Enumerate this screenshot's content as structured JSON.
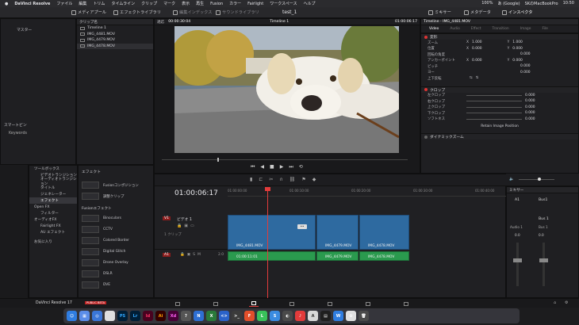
{
  "menubar": {
    "app": "DaVinci Resolve",
    "items": [
      "ファイル",
      "編集",
      "トリム",
      "タイムライン",
      "クリップ",
      "マーク",
      "表示",
      "再生",
      "Fusion",
      "カラー",
      "Fairlight",
      "ワークスペース",
      "ヘルプ"
    ],
    "battery": "100%",
    "input": "あ (Google)",
    "device": "SKのMacBookPro",
    "clock": "10:50"
  },
  "toolbar": {
    "media_pool": "メディアプール",
    "effects_library": "エフェクトライブラリ",
    "edit_index": "編集インデックス",
    "sound_library": "サウンドライブラリ",
    "project_title": "test_1",
    "mixer": "ミキサー",
    "metadata": "メタデータ",
    "inspector": "インスペクタ"
  },
  "mediapool": {
    "bin_header": "クリップ名",
    "master": "マスター",
    "clips": [
      "Timeline 1",
      "IMG_4481.MOV",
      "IMG_4479.MOV",
      "IMG_4478.MOV"
    ],
    "smart_bins": "スマートビン",
    "keywords": "Keywords"
  },
  "viewer": {
    "fit": "適応",
    "source_tc": "00:00:30:04",
    "timeline_name": "Timeline 1",
    "record_tc": "01:00:06:17"
  },
  "inspector": {
    "title": "Timeline - IMG_4481.MOV",
    "tabs": [
      "Video",
      "Audio",
      "Effect",
      "Transition",
      "Image",
      "File"
    ],
    "transform": "変形",
    "rows": [
      {
        "label": "ズーム",
        "x_lbl": "X",
        "x": "1.000",
        "y_lbl": "Y",
        "y": "1.000"
      },
      {
        "label": "位置",
        "x_lbl": "X",
        "x": "0.000",
        "y_lbl": "Y",
        "y": "0.000"
      },
      {
        "label": "回転の角度",
        "value": "0.000"
      },
      {
        "label": "アンカーポイント",
        "x_lbl": "X",
        "x": "0.000",
        "y_lbl": "Y",
        "y": "0.000"
      },
      {
        "label": "ピッチ",
        "value": "0.000"
      },
      {
        "label": "ヨー",
        "value": "0.000"
      },
      {
        "label": "上下反転",
        "value": ""
      }
    ],
    "crop": "クロップ",
    "crop_rows": [
      {
        "label": "左クロップ",
        "value": "0.000"
      },
      {
        "label": "右クロップ",
        "value": "0.000"
      },
      {
        "label": "上クロップ",
        "value": "0.000"
      },
      {
        "label": "下クロップ",
        "value": "0.000"
      },
      {
        "label": "ソフトネス",
        "value": "0.000"
      }
    ],
    "retain": "Retain Image Position",
    "dynamic_zoom": "ダイナミックズーム"
  },
  "effects": {
    "toolbox": "ツールボックス",
    "header": "エフェクト",
    "tree": [
      "ビデオトランジション",
      "オーディオトランジション",
      "タイトル",
      "ジェネレーター",
      "エフェクト",
      "Open FX",
      "フィルター",
      "オーディオFX",
      "Fairlight FX",
      "AU エフェクト",
      "お気に入り"
    ],
    "top_cards": [
      "Fusionコンポジション",
      "調整クリップ"
    ],
    "fusion_header": "Fusionエフェクト",
    "fusion_cards": [
      "Binoculars",
      "CCTV",
      "Colored Border",
      "Digital Glitch",
      "Drone Overlay",
      "DSLR",
      "DVE"
    ]
  },
  "timeline": {
    "timecode": "01:00:06:17",
    "ruler": [
      "01:00:00:00",
      "01:00:10:00",
      "01:00:20:00",
      "01:00:30:00",
      "01:00:40:00"
    ],
    "video_track": {
      "id": "V1",
      "name": "ビデオ 1",
      "sub": "1 クリップ"
    },
    "audio_track": {
      "id": "A1",
      "value": "2.0"
    },
    "video_clips": [
      "IMG_4481.MOV",
      "IMG_4479.MOV",
      "IMG_4478.MOV"
    ],
    "audio_clips": [
      "IMG_4481.MOV",
      "IMG_4479.MOV",
      "IMG_4478.MOV"
    ],
    "audio_clip_tc": "01:00:11:01"
  },
  "mixer": {
    "title": "ミキサー",
    "ch1": "A1",
    "ch2": "Bus1",
    "bus1": "Bus 1",
    "ch1_name": "Audio 1",
    "ch2_name": "Bus 1",
    "level": "0.0"
  },
  "footer": {
    "product": "DaVinci Resolve 17",
    "badge": "PUBLIC BETA"
  },
  "dock": [
    "PS",
    "Lr",
    "Id",
    "Ai",
    "Xd",
    "N",
    "S",
    "F",
    "A",
    "W"
  ]
}
